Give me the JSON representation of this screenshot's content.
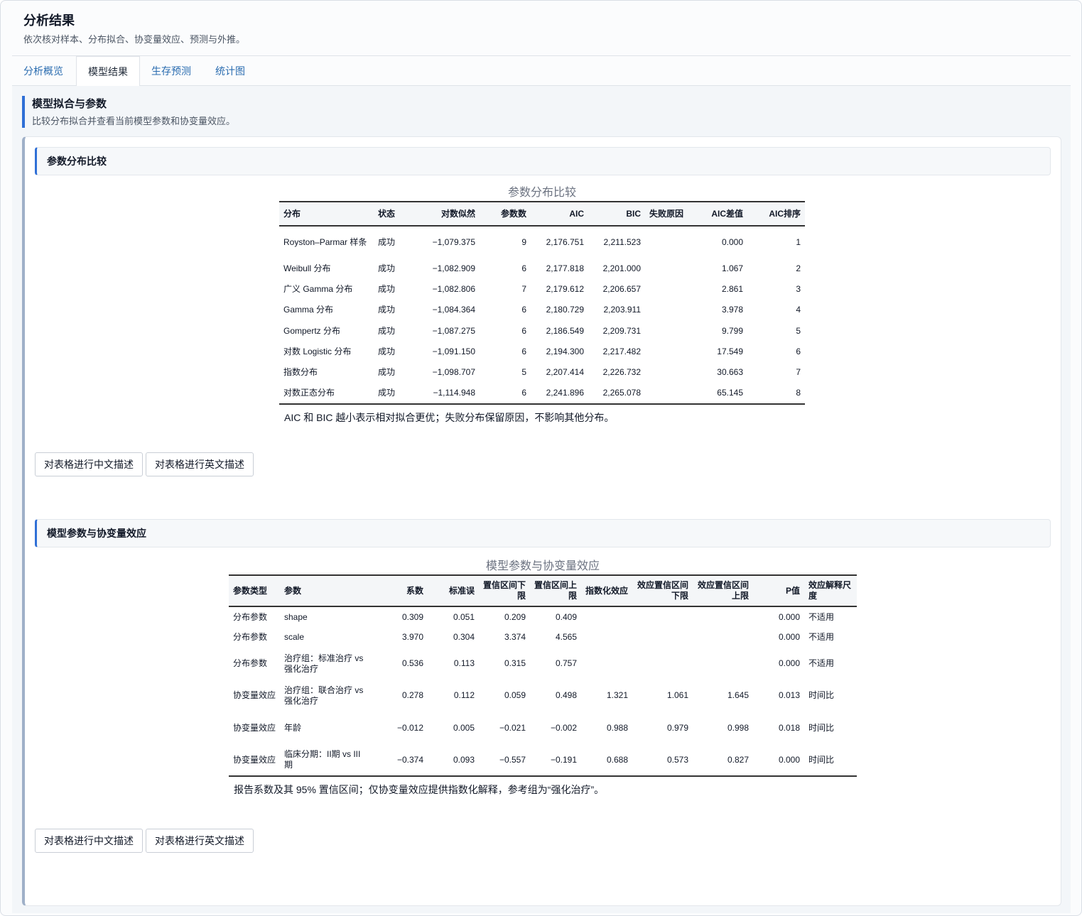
{
  "header": {
    "title": "分析结果",
    "subtitle": "依次核对样本、分布拟合、协变量效应、预测与外推。"
  },
  "tabs": {
    "overview": "分析概览",
    "models": "模型结果",
    "predict": "生存预测",
    "plots": "统计图"
  },
  "section": {
    "title": "模型拟合与参数",
    "desc": "比较分布拟合并查看当前模型参数和协变量效应。"
  },
  "dist_panel": {
    "title": "参数分布比较",
    "caption": "参数分布比较",
    "columns": [
      "分布",
      "状态",
      "对数似然",
      "参数数",
      "AIC",
      "BIC",
      "失败原因",
      "AIC差值",
      "AIC排序"
    ],
    "rows": [
      [
        "Royston–Parmar 样条",
        "成功",
        "−1,079.375",
        "9",
        "2,176.751",
        "2,211.523",
        "",
        "0.000",
        "1"
      ],
      [
        "Weibull 分布",
        "成功",
        "−1,082.909",
        "6",
        "2,177.818",
        "2,201.000",
        "",
        "1.067",
        "2"
      ],
      [
        "广义 Gamma 分布",
        "成功",
        "−1,082.806",
        "7",
        "2,179.612",
        "2,206.657",
        "",
        "2.861",
        "3"
      ],
      [
        "Gamma 分布",
        "成功",
        "−1,084.364",
        "6",
        "2,180.729",
        "2,203.911",
        "",
        "3.978",
        "4"
      ],
      [
        "Gompertz 分布",
        "成功",
        "−1,087.275",
        "6",
        "2,186.549",
        "2,209.731",
        "",
        "9.799",
        "5"
      ],
      [
        "对数 Logistic 分布",
        "成功",
        "−1,091.150",
        "6",
        "2,194.300",
        "2,217.482",
        "",
        "17.549",
        "6"
      ],
      [
        "指数分布",
        "成功",
        "−1,098.707",
        "5",
        "2,207.414",
        "2,226.732",
        "",
        "30.663",
        "7"
      ],
      [
        "对数正态分布",
        "成功",
        "−1,114.948",
        "6",
        "2,241.896",
        "2,265.078",
        "",
        "65.145",
        "8"
      ]
    ],
    "note": "AIC 和 BIC 越小表示相对拟合更优；失败分布保留原因，不影响其他分布。",
    "btn_cn": "对表格进行中文描述",
    "btn_en": "对表格进行英文描述"
  },
  "param_panel": {
    "title": "模型参数与协变量效应",
    "caption": "模型参数与协变量效应",
    "columns": [
      "参数类型",
      "参数",
      "系数",
      "标准误",
      "置信区间下限",
      "置信区间上限",
      "指数化效应",
      "效应置信区间下限",
      "效应置信区间上限",
      "P值",
      "效应解释尺度"
    ],
    "rows": [
      [
        "分布参数",
        "shape",
        "0.309",
        "0.051",
        "0.209",
        "0.409",
        "",
        "",
        "",
        "0.000",
        "不适用"
      ],
      [
        "分布参数",
        "scale",
        "3.970",
        "0.304",
        "3.374",
        "4.565",
        "",
        "",
        "",
        "0.000",
        "不适用"
      ],
      [
        "分布参数",
        "治疗组：标准治疗 vs 强化治疗",
        "0.536",
        "0.113",
        "0.315",
        "0.757",
        "",
        "",
        "",
        "0.000",
        "不适用"
      ],
      [
        "协变量效应",
        "治疗组：联合治疗 vs 强化治疗",
        "0.278",
        "0.112",
        "0.059",
        "0.498",
        "1.321",
        "1.061",
        "1.645",
        "0.013",
        "时间比"
      ],
      [
        "协变量效应",
        "年龄",
        "−0.012",
        "0.005",
        "−0.021",
        "−0.002",
        "0.988",
        "0.979",
        "0.998",
        "0.018",
        "时间比"
      ],
      [
        "协变量效应",
        "临床分期：II期 vs III期",
        "−0.374",
        "0.093",
        "−0.557",
        "−0.191",
        "0.688",
        "0.573",
        "0.827",
        "0.000",
        "时间比"
      ]
    ],
    "note": "报告系数及其 95% 置信区间；仅协变量效应提供指数化解释，参考组为“强化治疗”。",
    "btn_cn": "对表格进行中文描述",
    "btn_en": "对表格进行英文描述"
  },
  "colors": {
    "accent": "#2f6fd6",
    "tab_link": "#2a6cb0"
  }
}
